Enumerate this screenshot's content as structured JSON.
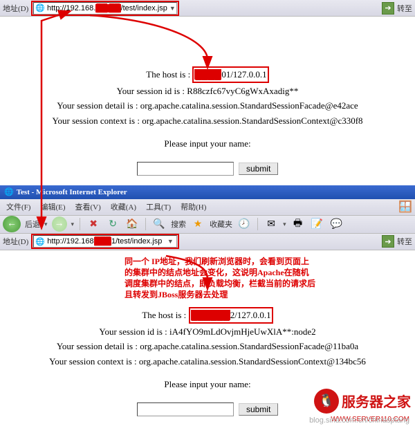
{
  "top": {
    "addr_label": "地址(D)",
    "url_prefix": "http://192.168.",
    "url_obscured": "██.██",
    "url_suffix": "/test/index.jsp",
    "go_label": "转至",
    "content": {
      "host_label": "The host is : ",
      "host_obscured": "████",
      "host_suffix": "01/127.0.0.1",
      "session_id_label": "Your session id is : ",
      "session_id": "R88czfc67vyC6gWxAxadig**",
      "session_detail_label": "Your session detail is : ",
      "session_detail": "org.apache.catalina.session.StandardSessionFacade@e42ace",
      "session_context_label": "Your session context is : ",
      "session_context": "org.apache.catalina.session.StandardSessionContext@c330f8",
      "prompt": "Please input your name:",
      "submit": "submit"
    }
  },
  "bottom": {
    "title": "Test - Microsoft Internet Explorer",
    "menu": {
      "file": "文件(F)",
      "edit": "编辑(E)",
      "view": "查看(V)",
      "fav": "收藏(A)",
      "tools": "工具(T)",
      "help": "帮助(H)"
    },
    "nav": {
      "back": "后退",
      "search": "搜索",
      "favorites": "收藏夹"
    },
    "addr_label": "地址(D)",
    "url_prefix": "http://192.168",
    "url_obscured": "███",
    "url_suffix": "1/test/index.jsp",
    "go_label": "转至",
    "annotation": {
      "l1": "同一个 IP地址，我们刷新浏览器时，会看到页面上",
      "l2": "的集群中的结点地址会变化，这说明Apache在随机",
      "l3": "调度集群中的结点，即负载均衡，栏截当前的请求后",
      "l4": "且转发到JBoss服务器去处理"
    },
    "content": {
      "host_label": "The host is : ",
      "host_obscured": "██████",
      "host_suffix": "2/127.0.0.1",
      "session_id_label": "Your session id is : ",
      "session_id": "iA4fYO9mLdOvjmHjeUwXlA**:node2",
      "session_detail_label": "Your session detail is : ",
      "session_detail": "org.apache.catalina.session.StandardSessionFacade@11ba0a",
      "session_context_label": "Your session context is : ",
      "session_context": "org.apache.catalina.session.StandardSessionContext@134bc56",
      "prompt": "Please input your name:",
      "submit": "submit"
    }
  },
  "watermark": {
    "text": "服务器之家",
    "url": "WWW.SERVER110.COM",
    "blog": "blog.sina.com.cn/chinasptang"
  }
}
